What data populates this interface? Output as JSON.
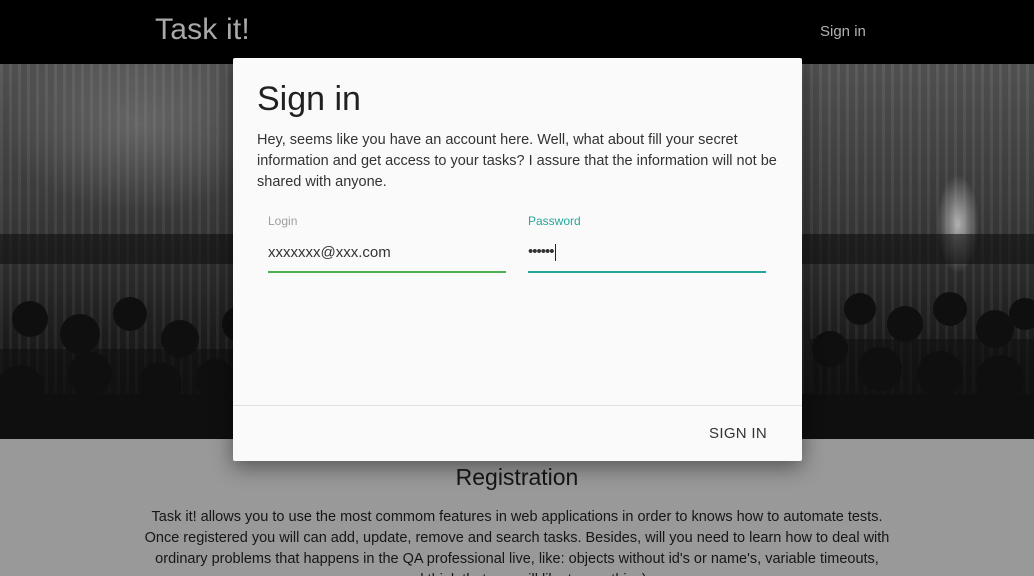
{
  "header": {
    "brand": "Task it!",
    "nav_signin": "Sign in"
  },
  "modal": {
    "title": "Sign in",
    "description": "Hey, seems like you have an account here. Well, what about fill your secret information and get access to your tasks? I assure that the information will not be shared with anyone.",
    "login": {
      "label": "Login",
      "value": "xxxxxxx@xxx.com"
    },
    "password": {
      "label": "Password",
      "masked_value": "••••••"
    },
    "submit_label": "SIGN IN"
  },
  "registration": {
    "title": "Registration",
    "text": "Task it! allows you to use the most commom features in web applications in order to knows how to automate tests. Once registered you will can add, update, remove and search tasks. Besides, will you need to learn how to deal with ordinary problems that happens in the QA professional live, like: objects without id's or name's, variable timeouts, ...and think that you will like to see this :)"
  },
  "colors": {
    "accent_teal": "#26a69a",
    "valid_green": "#4caf50",
    "topbar": "#000000"
  }
}
